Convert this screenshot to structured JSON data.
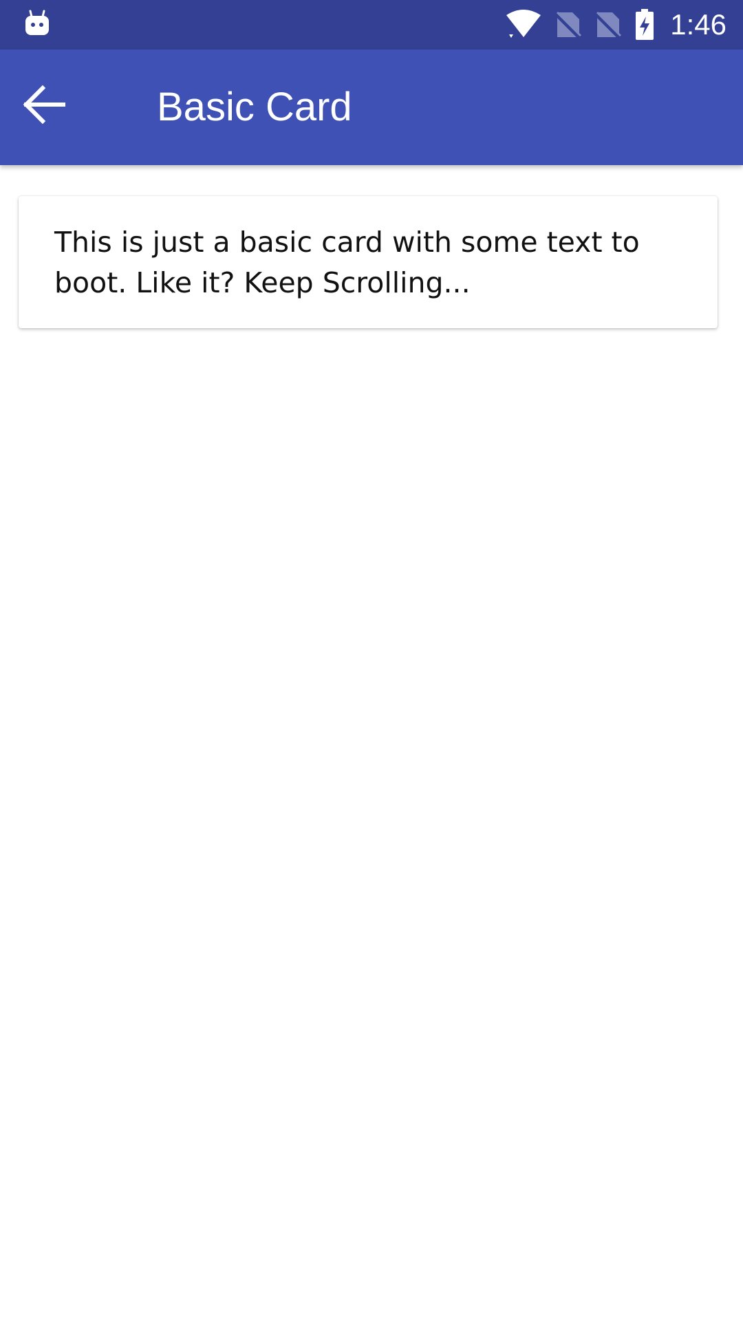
{
  "status_bar": {
    "time": "1:46",
    "background_color": "#334093",
    "icons": [
      "android-debug-icon",
      "wifi-icon",
      "no-sim-icon",
      "no-sim-icon",
      "battery-charging-icon"
    ]
  },
  "app_bar": {
    "title": "Basic Card",
    "background_color": "#3f51b5",
    "back_icon": "arrow-back-icon"
  },
  "card": {
    "text": "This is just a basic card with some text to boot. Like it? Keep Scrolling..."
  }
}
